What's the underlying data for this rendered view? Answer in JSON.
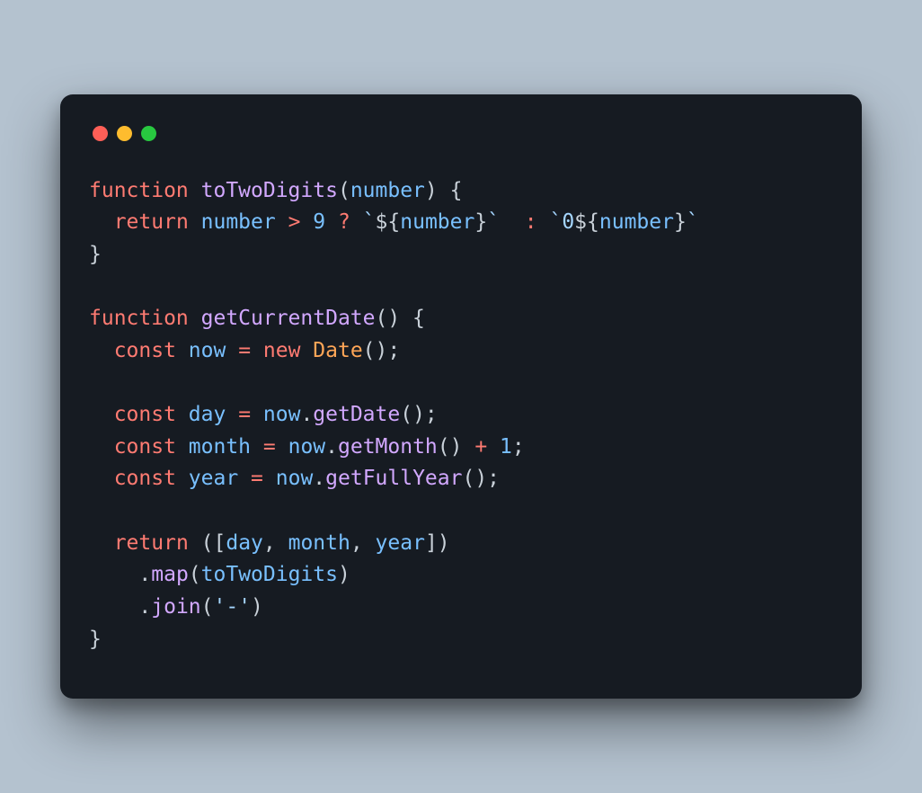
{
  "window": {
    "traffic_lights": [
      "close",
      "minimize",
      "zoom"
    ]
  },
  "code": {
    "lines": [
      [
        {
          "t": "function ",
          "c": "tok-kw"
        },
        {
          "t": "toTwoDigits",
          "c": "tok-fn"
        },
        {
          "t": "(",
          "c": "tok-pun"
        },
        {
          "t": "number",
          "c": "tok-id"
        },
        {
          "t": ") {",
          "c": "tok-pun"
        }
      ],
      [
        {
          "t": "  ",
          "c": "tok-pun"
        },
        {
          "t": "return ",
          "c": "tok-kw"
        },
        {
          "t": "number ",
          "c": "tok-id"
        },
        {
          "t": "> ",
          "c": "tok-op"
        },
        {
          "t": "9 ",
          "c": "tok-numc"
        },
        {
          "t": "? ",
          "c": "tok-op"
        },
        {
          "t": "`",
          "c": "tok-str"
        },
        {
          "t": "${",
          "c": "tok-pun"
        },
        {
          "t": "number",
          "c": "tok-id"
        },
        {
          "t": "}",
          "c": "tok-pun"
        },
        {
          "t": "`",
          "c": "tok-str"
        },
        {
          "t": "  ",
          "c": "tok-pun"
        },
        {
          "t": ": ",
          "c": "tok-op"
        },
        {
          "t": "`0",
          "c": "tok-str"
        },
        {
          "t": "${",
          "c": "tok-pun"
        },
        {
          "t": "number",
          "c": "tok-id"
        },
        {
          "t": "}",
          "c": "tok-pun"
        },
        {
          "t": "`",
          "c": "tok-str"
        }
      ],
      [
        {
          "t": "}",
          "c": "tok-pun"
        }
      ],
      [
        {
          "t": "",
          "c": "tok-pun"
        }
      ],
      [
        {
          "t": "function ",
          "c": "tok-kw"
        },
        {
          "t": "getCurrentDate",
          "c": "tok-fn"
        },
        {
          "t": "() {",
          "c": "tok-pun"
        }
      ],
      [
        {
          "t": "  ",
          "c": "tok-pun"
        },
        {
          "t": "const ",
          "c": "tok-kw"
        },
        {
          "t": "now ",
          "c": "tok-id"
        },
        {
          "t": "= ",
          "c": "tok-op"
        },
        {
          "t": "new ",
          "c": "tok-kw"
        },
        {
          "t": "Date",
          "c": "tok-type"
        },
        {
          "t": "();",
          "c": "tok-pun"
        }
      ],
      [
        {
          "t": "",
          "c": "tok-pun"
        }
      ],
      [
        {
          "t": "  ",
          "c": "tok-pun"
        },
        {
          "t": "const ",
          "c": "tok-kw"
        },
        {
          "t": "day ",
          "c": "tok-id"
        },
        {
          "t": "= ",
          "c": "tok-op"
        },
        {
          "t": "now",
          "c": "tok-id"
        },
        {
          "t": ".",
          "c": "tok-pun"
        },
        {
          "t": "getDate",
          "c": "tok-fn"
        },
        {
          "t": "();",
          "c": "tok-pun"
        }
      ],
      [
        {
          "t": "  ",
          "c": "tok-pun"
        },
        {
          "t": "const ",
          "c": "tok-kw"
        },
        {
          "t": "month ",
          "c": "tok-id"
        },
        {
          "t": "= ",
          "c": "tok-op"
        },
        {
          "t": "now",
          "c": "tok-id"
        },
        {
          "t": ".",
          "c": "tok-pun"
        },
        {
          "t": "getMonth",
          "c": "tok-fn"
        },
        {
          "t": "() ",
          "c": "tok-pun"
        },
        {
          "t": "+ ",
          "c": "tok-op"
        },
        {
          "t": "1",
          "c": "tok-numc"
        },
        {
          "t": ";",
          "c": "tok-pun"
        }
      ],
      [
        {
          "t": "  ",
          "c": "tok-pun"
        },
        {
          "t": "const ",
          "c": "tok-kw"
        },
        {
          "t": "year ",
          "c": "tok-id"
        },
        {
          "t": "= ",
          "c": "tok-op"
        },
        {
          "t": "now",
          "c": "tok-id"
        },
        {
          "t": ".",
          "c": "tok-pun"
        },
        {
          "t": "getFullYear",
          "c": "tok-fn"
        },
        {
          "t": "();",
          "c": "tok-pun"
        }
      ],
      [
        {
          "t": "",
          "c": "tok-pun"
        }
      ],
      [
        {
          "t": "  ",
          "c": "tok-pun"
        },
        {
          "t": "return ",
          "c": "tok-kw"
        },
        {
          "t": "([",
          "c": "tok-pun"
        },
        {
          "t": "day",
          "c": "tok-id"
        },
        {
          "t": ", ",
          "c": "tok-pun"
        },
        {
          "t": "month",
          "c": "tok-id"
        },
        {
          "t": ", ",
          "c": "tok-pun"
        },
        {
          "t": "year",
          "c": "tok-id"
        },
        {
          "t": "])",
          "c": "tok-pun"
        }
      ],
      [
        {
          "t": "    .",
          "c": "tok-pun"
        },
        {
          "t": "map",
          "c": "tok-fn"
        },
        {
          "t": "(",
          "c": "tok-pun"
        },
        {
          "t": "toTwoDigits",
          "c": "tok-id"
        },
        {
          "t": ")",
          "c": "tok-pun"
        }
      ],
      [
        {
          "t": "    .",
          "c": "tok-pun"
        },
        {
          "t": "join",
          "c": "tok-fn"
        },
        {
          "t": "(",
          "c": "tok-pun"
        },
        {
          "t": "'-'",
          "c": "tok-str"
        },
        {
          "t": ")",
          "c": "tok-pun"
        }
      ],
      [
        {
          "t": "}",
          "c": "tok-pun"
        }
      ]
    ]
  },
  "colors": {
    "bg": "#b4c2cf",
    "window": "#161b22",
    "red": "#ff5f57",
    "yellow": "#febc2e",
    "green": "#28c840"
  }
}
